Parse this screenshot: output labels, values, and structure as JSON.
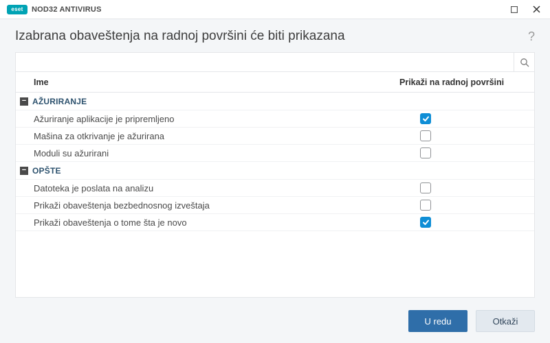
{
  "brand": {
    "logo": "eset",
    "product": "NOD32 ANTIVIRUS"
  },
  "header": {
    "title": "Izabrana obaveštenja na radnoj površini će biti prikazana",
    "help": "?"
  },
  "search": {
    "value": ""
  },
  "columns": {
    "name": "Ime",
    "show": "Prikaži na radnoj površini"
  },
  "groups": [
    {
      "label": "AŽURIRANJE",
      "items": [
        {
          "label": "Ažuriranje aplikacije je pripremljeno",
          "checked": true
        },
        {
          "label": "Mašina za otkrivanje je ažurirana",
          "checked": false
        },
        {
          "label": "Moduli su ažurirani",
          "checked": false
        }
      ]
    },
    {
      "label": "OPŠTE",
      "items": [
        {
          "label": "Datoteka je poslata na analizu",
          "checked": false
        },
        {
          "label": "Prikaži obaveštenja bezbednosnog izveštaja",
          "checked": false
        },
        {
          "label": "Prikaži obaveštenja o tome šta je novo",
          "checked": true
        }
      ]
    }
  ],
  "footer": {
    "ok": "U redu",
    "cancel": "Otkaži"
  }
}
